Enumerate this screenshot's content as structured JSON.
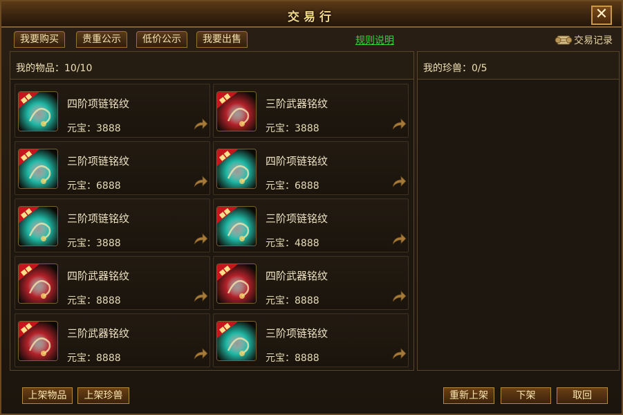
{
  "window": {
    "title": "交易行",
    "close_label": "✕"
  },
  "tabs": [
    {
      "label": "我要购买"
    },
    {
      "label": "贵重公示"
    },
    {
      "label": "低价公示"
    },
    {
      "label": "我要出售"
    }
  ],
  "rules_link": "规则说明",
  "records_label": "交易记录",
  "left_panel": {
    "header": "我的物品：10/10"
  },
  "right_panel": {
    "header": "我的珍兽：0/5"
  },
  "items": [
    {
      "name": "四阶项链铭纹",
      "price": "元宝：3888",
      "icon": "necklace-inscription-icon",
      "color": "#1fb7a4"
    },
    {
      "name": "三阶武器铭纹",
      "price": "元宝：3888",
      "icon": "weapon-inscription-icon",
      "color": "#b3222a"
    },
    {
      "name": "三阶项链铭纹",
      "price": "元宝：6888",
      "icon": "necklace-inscription-icon",
      "color": "#1fb7a4"
    },
    {
      "name": "四阶项链铭纹",
      "price": "元宝：6888",
      "icon": "necklace-inscription-icon",
      "color": "#1fb7a4"
    },
    {
      "name": "三阶项链铭纹",
      "price": "元宝：3888",
      "icon": "necklace-inscription-icon",
      "color": "#1fb7a4"
    },
    {
      "name": "三阶项链铭纹",
      "price": "元宝：4888",
      "icon": "necklace-inscription-icon",
      "color": "#1fb7a4"
    },
    {
      "name": "四阶武器铭纹",
      "price": "元宝：8888",
      "icon": "weapon-inscription-icon",
      "color": "#b3222a"
    },
    {
      "name": "四阶武器铭纹",
      "price": "元宝：8888",
      "icon": "weapon-inscription-icon",
      "color": "#b3222a"
    },
    {
      "name": "三阶武器铭纹",
      "price": "元宝：8888",
      "icon": "weapon-inscription-icon",
      "color": "#b3222a"
    },
    {
      "name": "三阶项链铭纹",
      "price": "元宝：8888",
      "icon": "necklace-inscription-icon",
      "color": "#1fb7a4"
    }
  ],
  "buttons": {
    "list_item": "上架物品",
    "list_pet": "上架珍兽",
    "relist": "重新上架",
    "delist": "下架",
    "retrieve": "取回"
  }
}
